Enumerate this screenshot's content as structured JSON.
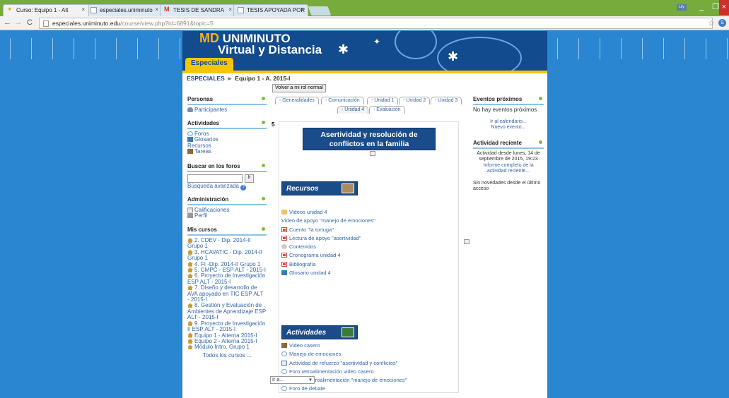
{
  "browser": {
    "tabs": [
      {
        "label": "Curso: Equipo 1 - Alt"
      },
      {
        "label": "especiales.uniminuto"
      },
      {
        "label": "TESIS DE SANDRA"
      },
      {
        "label": "TESIS APOYADA POR"
      }
    ],
    "url_host": "especiales.uniminuto.edu",
    "url_path": "/course/view.php?id=6891&topic=5",
    "user_badge": "Lily",
    "accent": "#77ab3b"
  },
  "site": {
    "logo_md": "MD",
    "logo_line1": "UNIMINUTO",
    "logo_line2": "Virtual y Distancia",
    "category_tab": "Especiales"
  },
  "breadcrumb": {
    "root": "ESPECIALES",
    "sep": "►",
    "current": "Equipo 1 - A. 2015-I"
  },
  "role_button": "Volver a mi rol normal",
  "left": {
    "personas": {
      "title": "Personas",
      "items": [
        "Participantes"
      ]
    },
    "actividades": {
      "title": "Actividades",
      "items": [
        "Foros",
        "Glosarios",
        "Recursos",
        "Tareas"
      ]
    },
    "buscar": {
      "title": "Buscar en los foros",
      "go": "Ir",
      "advanced": "Búsqueda avanzada"
    },
    "admin": {
      "title": "Administración",
      "items": [
        "Calificaciones",
        "Perfil"
      ]
    },
    "cursos": {
      "title": "Mis cursos",
      "items": [
        "2. CDEV - Dip. 2014-II Grupo 1",
        "3. HCAVATIC - Dip. 2014-II Grupo 1",
        "4. FI -Dip. 2014-II Grupo 1",
        "5. CMPC - ESP ALT - 2015-I",
        "6. Proyecto de Investigación ESP ALT - 2015-I",
        "7. Diseño y desarrollo de AVA apoyado en TIC ESP ALT - 2015-I",
        "8. Gestión y Evaluación de Ambientes de Aprendizaje ESP ALT - 2015-I",
        "9. Proyecto de Investigación II ESP ALT - 2015-I",
        "Equipo 1 - Alterna 2015-I",
        "Equipo 2 - Alterna 2015-I",
        "Módulo Intro. Grupo 1"
      ],
      "all": "Todos los cursos ..."
    }
  },
  "tabs": [
    "- Generalidades",
    "- Comunicación",
    "- Unidad 1",
    "- Unidad 2",
    "- Unidad 3",
    "- Unidad 4",
    "- Evaluación"
  ],
  "section": {
    "number": "5",
    "title_line1": "Asertividad y resolución de",
    "title_line2": "conflictos en la familia",
    "recursos_header": "Recursos",
    "recursos": [
      {
        "label": "Videos unidad 4",
        "icon": "folder-icon"
      },
      {
        "label": "Video de apoyo \"manejo de emociones\"",
        "icon": "page-icon"
      },
      {
        "label": "Cuento \"la tortuga\"",
        "icon": "pdf-icon"
      },
      {
        "label": "Lectura de apoyo \"asertividad\"",
        "icon": "pdf-icon"
      },
      {
        "label": "Contenidos",
        "icon": "resource-icon"
      },
      {
        "label": "Cronograma unidad 4",
        "icon": "pdf-icon"
      },
      {
        "label": "Bibliografía",
        "icon": "pdf-icon"
      },
      {
        "label": "Glosario unidad 4",
        "icon": "glossary-icon"
      }
    ],
    "actividades_header": "Actividades",
    "actividades": [
      {
        "label": "Video casero",
        "icon": "video-icon"
      },
      {
        "label": "Manejo de emociones",
        "icon": "forum-icon"
      },
      {
        "label": "Actividad de refuerzo \"asertividad y conflictos\"",
        "icon": "assignment-icon"
      },
      {
        "label": "Foro retroalimentación video casero",
        "icon": "forum-icon"
      },
      {
        "label": "Foro de retroalimentación \"manejo de emociones\"",
        "icon": "forum-icon"
      },
      {
        "label": "Foro de debate",
        "icon": "forum-icon"
      }
    ],
    "jump": "Ir a..."
  },
  "right": {
    "eventos": {
      "title": "Eventos próximos",
      "none": "No hay eventos próximos",
      "calendar": "Ir al calendario...",
      "new": "Nuevo evento..."
    },
    "reciente": {
      "title": "Actividad reciente",
      "since": "Actividad desde lunes, 14 de septiembre de 2015, 19:23",
      "report": "Informe completo de la actividad reciente...",
      "none": "Sin novedades desde el último acceso"
    }
  }
}
